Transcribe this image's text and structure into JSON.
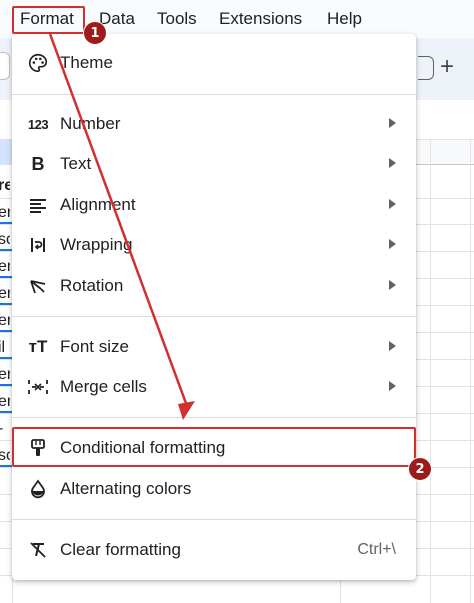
{
  "menubar": {
    "items": [
      "Format",
      "Data",
      "Tools",
      "Extensions",
      "Help"
    ]
  },
  "sheet": {
    "cell_fragments": [
      "re",
      "er",
      "so",
      "er",
      "er",
      "er",
      "il",
      "er",
      "er",
      "-",
      "so"
    ]
  },
  "format_menu": {
    "items": [
      {
        "label": "Theme",
        "icon": "palette-icon",
        "submenu": false
      },
      {
        "label": "Number",
        "icon": "number-format-icon",
        "icon_text": "123",
        "submenu": true
      },
      {
        "label": "Text",
        "icon": "bold-icon",
        "icon_text": "B",
        "submenu": true
      },
      {
        "label": "Alignment",
        "icon": "align-left-icon",
        "submenu": true
      },
      {
        "label": "Wrapping",
        "icon": "text-wrap-icon",
        "submenu": true
      },
      {
        "label": "Rotation",
        "icon": "text-rotation-icon",
        "submenu": true
      },
      {
        "label": "Font size",
        "icon": "font-size-icon",
        "icon_text": "тT",
        "submenu": true
      },
      {
        "label": "Merge cells",
        "icon": "merge-cells-icon",
        "submenu": true
      },
      {
        "label": "Conditional formatting",
        "icon": "paint-roller-icon",
        "submenu": false
      },
      {
        "label": "Alternating colors",
        "icon": "half-filled-drop-icon",
        "submenu": false
      },
      {
        "label": "Clear formatting",
        "icon": "clear-format-icon",
        "submenu": false,
        "shortcut": "Ctrl+\\"
      }
    ]
  },
  "annotations": {
    "step1": "1",
    "step2": "2",
    "color": "#d32f2f",
    "badge_color": "#9c1c1c"
  }
}
